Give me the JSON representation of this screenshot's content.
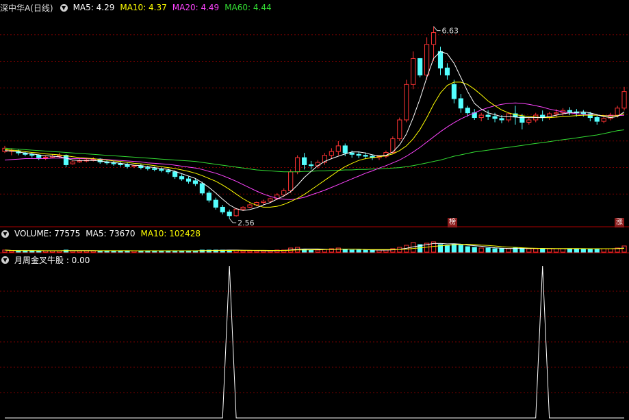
{
  "main_header": {
    "title": "深中华A(日线)",
    "ma5": "MA5: 4.29",
    "ma10": "MA10: 4.37",
    "ma20": "MA20: 4.49",
    "ma60": "MA60: 4.44"
  },
  "volume_header": {
    "label": "VOLUME: 77575",
    "ma5": "MA5: 73670",
    "ma10": "MA10: 102428"
  },
  "indicator_header": {
    "label": "月周金叉牛股 : 0.00"
  },
  "badges": {
    "left": "榜",
    "right": "涨"
  },
  "colors": {
    "up": "#ff3333",
    "down": "#54ffff",
    "ma5": "#ffffff",
    "ma10": "#ffff00",
    "ma20": "#ff44ff",
    "ma60": "#33dd33",
    "grid": "#7a0000"
  },
  "chart_data": [
    {
      "type": "candlestick",
      "annotations": [
        {
          "text": "6.63",
          "x": 63,
          "y": 6.63
        },
        {
          "text": "2.56",
          "x": 33,
          "y": 2.56
        }
      ],
      "ylim": [
        2.4,
        6.9
      ],
      "grid": true,
      "candles": [
        [
          3.98,
          4.1,
          4.05,
          3.95
        ],
        [
          4.0,
          4.05,
          4.0,
          3.9
        ],
        [
          3.98,
          4.02,
          3.95,
          3.9
        ],
        [
          3.95,
          3.98,
          3.92,
          3.88
        ],
        [
          3.92,
          3.95,
          3.9,
          3.85
        ],
        [
          3.9,
          3.92,
          3.85,
          3.8
        ],
        [
          3.85,
          3.9,
          3.86,
          3.8
        ],
        [
          3.86,
          3.92,
          3.88,
          3.84
        ],
        [
          3.88,
          3.95,
          3.9,
          3.84
        ],
        [
          3.9,
          3.92,
          3.7,
          3.65
        ],
        [
          3.72,
          3.8,
          3.76,
          3.7
        ],
        [
          3.76,
          3.82,
          3.78,
          3.74
        ],
        [
          3.78,
          3.84,
          3.8,
          3.75
        ],
        [
          3.8,
          3.86,
          3.82,
          3.77
        ],
        [
          3.82,
          3.84,
          3.76,
          3.72
        ],
        [
          3.76,
          3.8,
          3.74,
          3.7
        ],
        [
          3.74,
          3.78,
          3.72,
          3.68
        ],
        [
          3.72,
          3.76,
          3.7,
          3.66
        ],
        [
          3.7,
          3.74,
          3.66,
          3.62
        ],
        [
          3.66,
          3.7,
          3.68,
          3.63
        ],
        [
          3.68,
          3.72,
          3.64,
          3.6
        ],
        [
          3.64,
          3.68,
          3.62,
          3.58
        ],
        [
          3.62,
          3.66,
          3.6,
          3.56
        ],
        [
          3.6,
          3.64,
          3.58,
          3.54
        ],
        [
          3.58,
          3.62,
          3.55,
          3.5
        ],
        [
          3.55,
          3.58,
          3.45,
          3.4
        ],
        [
          3.45,
          3.5,
          3.4,
          3.36
        ],
        [
          3.4,
          3.45,
          3.35,
          3.3
        ],
        [
          3.36,
          3.4,
          3.3,
          3.25
        ],
        [
          3.3,
          3.34,
          3.1,
          3.05
        ],
        [
          3.1,
          3.15,
          2.95,
          2.9
        ],
        [
          2.95,
          3.0,
          2.8,
          2.75
        ],
        [
          2.8,
          2.85,
          2.7,
          2.65
        ],
        [
          2.7,
          2.75,
          2.62,
          2.56
        ],
        [
          2.62,
          2.78,
          2.76,
          2.6
        ],
        [
          2.76,
          2.82,
          2.8,
          2.72
        ],
        [
          2.8,
          2.88,
          2.85,
          2.78
        ],
        [
          2.85,
          2.92,
          2.9,
          2.82
        ],
        [
          2.9,
          2.96,
          2.93,
          2.86
        ],
        [
          2.93,
          3.0,
          2.98,
          2.9
        ],
        [
          2.98,
          3.1,
          3.06,
          2.95
        ],
        [
          3.06,
          3.2,
          3.15,
          3.02
        ],
        [
          3.15,
          3.6,
          3.55,
          3.1
        ],
        [
          3.55,
          3.9,
          3.85,
          3.5
        ],
        [
          3.85,
          3.95,
          3.7,
          3.6
        ],
        [
          3.7,
          3.78,
          3.68,
          3.6
        ],
        [
          3.68,
          3.8,
          3.75,
          3.62
        ],
        [
          3.75,
          3.95,
          3.9,
          3.7
        ],
        [
          3.9,
          4.05,
          3.98,
          3.82
        ],
        [
          3.98,
          4.2,
          4.1,
          3.9
        ],
        [
          4.1,
          4.15,
          3.95,
          3.88
        ],
        [
          3.95,
          4.0,
          3.92,
          3.85
        ],
        [
          3.92,
          3.98,
          3.9,
          3.84
        ],
        [
          3.9,
          3.96,
          3.88,
          3.82
        ],
        [
          3.88,
          3.92,
          3.85,
          3.8
        ],
        [
          3.85,
          3.9,
          3.88,
          3.8
        ],
        [
          3.88,
          4.0,
          3.96,
          3.84
        ],
        [
          3.96,
          4.3,
          4.25,
          3.92
        ],
        [
          4.25,
          4.7,
          4.65,
          4.2
        ],
        [
          4.65,
          5.5,
          5.4,
          4.6
        ],
        [
          5.4,
          6.1,
          5.95,
          5.3
        ],
        [
          5.95,
          5.8,
          5.6,
          5.55
        ],
        [
          5.6,
          6.4,
          6.25,
          5.5
        ],
        [
          6.25,
          6.63,
          6.5,
          5.9
        ],
        [
          6.1,
          6.2,
          5.75,
          5.6
        ],
        [
          5.75,
          5.85,
          5.6,
          5.5
        ],
        [
          5.4,
          5.5,
          5.1,
          5.0
        ],
        [
          5.1,
          5.2,
          4.9,
          4.8
        ],
        [
          4.9,
          4.95,
          4.8,
          4.72
        ],
        [
          4.8,
          4.88,
          4.7,
          4.65
        ],
        [
          4.7,
          4.8,
          4.75,
          4.62
        ],
        [
          4.75,
          4.85,
          4.72,
          4.65
        ],
        [
          4.72,
          4.8,
          4.68,
          4.6
        ],
        [
          4.68,
          4.75,
          4.65,
          4.58
        ],
        [
          4.65,
          4.8,
          4.78,
          4.6
        ],
        [
          4.78,
          4.95,
          4.72,
          4.55
        ],
        [
          4.72,
          4.78,
          4.6,
          4.45
        ],
        [
          4.6,
          4.7,
          4.65,
          4.55
        ],
        [
          4.65,
          4.8,
          4.75,
          4.6
        ],
        [
          4.75,
          4.85,
          4.7,
          4.62
        ],
        [
          4.7,
          4.82,
          4.78,
          4.65
        ],
        [
          4.78,
          4.88,
          4.8,
          4.7
        ],
        [
          4.8,
          4.9,
          4.85,
          4.74
        ],
        [
          4.85,
          4.92,
          4.82,
          4.75
        ],
        [
          4.82,
          4.88,
          4.8,
          4.72
        ],
        [
          4.8,
          4.86,
          4.78,
          4.72
        ],
        [
          4.78,
          4.82,
          4.7,
          4.62
        ],
        [
          4.7,
          4.74,
          4.62,
          4.55
        ],
        [
          4.62,
          4.72,
          4.68,
          4.58
        ],
        [
          4.68,
          4.8,
          4.75,
          4.64
        ],
        [
          4.75,
          4.95,
          4.9,
          4.7
        ],
        [
          4.9,
          5.35,
          5.25,
          4.85
        ]
      ],
      "ma5": [
        4.0,
        3.99,
        3.97,
        3.95,
        3.93,
        3.91,
        3.89,
        3.88,
        3.87,
        3.84,
        3.8,
        3.79,
        3.79,
        3.79,
        3.78,
        3.76,
        3.75,
        3.73,
        3.71,
        3.69,
        3.68,
        3.66,
        3.64,
        3.62,
        3.6,
        3.56,
        3.51,
        3.46,
        3.41,
        3.32,
        3.22,
        3.1,
        2.97,
        2.85,
        2.77,
        2.73,
        2.75,
        2.79,
        2.85,
        2.9,
        2.97,
        3.04,
        3.13,
        3.27,
        3.43,
        3.56,
        3.68,
        3.77,
        3.83,
        3.88,
        3.93,
        3.97,
        3.97,
        3.95,
        3.91,
        3.89,
        3.9,
        3.97,
        4.12,
        4.35,
        4.7,
        5.1,
        5.55,
        5.95,
        6.1,
        6.05,
        5.85,
        5.55,
        5.25,
        5.0,
        4.88,
        4.8,
        4.76,
        4.72,
        4.72,
        4.71,
        4.7,
        4.7,
        4.7,
        4.7,
        4.72,
        4.75,
        4.78,
        4.8,
        4.81,
        4.82,
        4.8,
        4.76,
        4.72,
        4.7,
        4.72,
        4.82
      ],
      "ma10": [
        4.02,
        4.01,
        4.0,
        3.98,
        3.96,
        3.95,
        3.93,
        3.92,
        3.91,
        3.89,
        3.87,
        3.85,
        3.84,
        3.83,
        3.81,
        3.8,
        3.78,
        3.77,
        3.75,
        3.73,
        3.72,
        3.7,
        3.68,
        3.66,
        3.64,
        3.62,
        3.59,
        3.56,
        3.52,
        3.47,
        3.41,
        3.35,
        3.27,
        3.18,
        3.08,
        2.98,
        2.9,
        2.84,
        2.8,
        2.8,
        2.82,
        2.86,
        2.92,
        2.99,
        3.07,
        3.17,
        3.27,
        3.37,
        3.47,
        3.57,
        3.66,
        3.73,
        3.79,
        3.83,
        3.85,
        3.87,
        3.89,
        3.93,
        4.0,
        4.1,
        4.25,
        4.45,
        4.7,
        4.98,
        5.22,
        5.38,
        5.45,
        5.45,
        5.4,
        5.3,
        5.18,
        5.05,
        4.95,
        4.86,
        4.8,
        4.76,
        4.74,
        4.72,
        4.71,
        4.7,
        4.7,
        4.71,
        4.72,
        4.73,
        4.74,
        4.75,
        4.75,
        4.75,
        4.74,
        4.73,
        4.74,
        4.78
      ],
      "ma20": [
        3.8,
        3.81,
        3.82,
        3.83,
        3.83,
        3.83,
        3.83,
        3.84,
        3.84,
        3.84,
        3.83,
        3.83,
        3.83,
        3.82,
        3.82,
        3.81,
        3.8,
        3.79,
        3.78,
        3.77,
        3.76,
        3.74,
        3.73,
        3.72,
        3.71,
        3.69,
        3.67,
        3.65,
        3.63,
        3.6,
        3.56,
        3.52,
        3.47,
        3.41,
        3.35,
        3.28,
        3.21,
        3.14,
        3.08,
        3.03,
        2.99,
        2.97,
        2.96,
        2.98,
        3.01,
        3.06,
        3.11,
        3.16,
        3.22,
        3.28,
        3.34,
        3.4,
        3.46,
        3.52,
        3.57,
        3.63,
        3.68,
        3.74,
        3.8,
        3.88,
        3.97,
        4.07,
        4.18,
        4.29,
        4.4,
        4.5,
        4.59,
        4.67,
        4.74,
        4.8,
        4.86,
        4.91,
        4.95,
        4.98,
        5.0,
        5.01,
        5.0,
        4.98,
        4.95,
        4.92,
        4.88,
        4.85,
        4.82,
        4.8,
        4.78,
        4.77,
        4.76,
        4.75,
        4.74,
        4.74,
        4.74,
        4.75
      ],
      "ma60": [
        4.05,
        4.04,
        4.03,
        4.02,
        4.01,
        4.0,
        3.99,
        3.98,
        3.97,
        3.96,
        3.95,
        3.94,
        3.93,
        3.92,
        3.91,
        3.9,
        3.89,
        3.88,
        3.87,
        3.86,
        3.85,
        3.84,
        3.83,
        3.82,
        3.81,
        3.8,
        3.79,
        3.78,
        3.77,
        3.75,
        3.73,
        3.71,
        3.69,
        3.67,
        3.65,
        3.63,
        3.61,
        3.59,
        3.58,
        3.57,
        3.56,
        3.55,
        3.55,
        3.55,
        3.56,
        3.56,
        3.57,
        3.57,
        3.58,
        3.58,
        3.59,
        3.59,
        3.6,
        3.6,
        3.61,
        3.61,
        3.62,
        3.63,
        3.64,
        3.66,
        3.68,
        3.71,
        3.74,
        3.77,
        3.8,
        3.84,
        3.88,
        3.91,
        3.94,
        3.97,
        3.99,
        4.01,
        4.03,
        4.05,
        4.07,
        4.09,
        4.11,
        4.13,
        4.15,
        4.17,
        4.19,
        4.21,
        4.23,
        4.25,
        4.27,
        4.29,
        4.31,
        4.33,
        4.36,
        4.39,
        4.42,
        4.44
      ]
    },
    {
      "type": "bar",
      "volumes": [
        3,
        2,
        2,
        2,
        2,
        2,
        2,
        2,
        2,
        3,
        2,
        2,
        2,
        2,
        2,
        2,
        2,
        2,
        2,
        2,
        2,
        2,
        2,
        2,
        2,
        2,
        2,
        2,
        2,
        3,
        3,
        3,
        3,
        3,
        3,
        2,
        2,
        2,
        2,
        2,
        3,
        3,
        6,
        7,
        4,
        3,
        3,
        4,
        5,
        6,
        4,
        3,
        3,
        3,
        3,
        3,
        3,
        5,
        7,
        10,
        14,
        11,
        13,
        15,
        11,
        10,
        12,
        10,
        8,
        7,
        6,
        6,
        5,
        5,
        5,
        6,
        6,
        5,
        5,
        5,
        5,
        5,
        5,
        5,
        5,
        5,
        5,
        5,
        5,
        5,
        6,
        9
      ],
      "ylim": [
        0,
        16
      ]
    },
    {
      "type": "line",
      "values": [
        0,
        0,
        0,
        0,
        0,
        0,
        0,
        0,
        0,
        0,
        0,
        0,
        0,
        0,
        0,
        0,
        0,
        0,
        0,
        0,
        0,
        0,
        0,
        0,
        0,
        0,
        0,
        0,
        0,
        0,
        0,
        0,
        0,
        1,
        0,
        0,
        0,
        0,
        0,
        0,
        0,
        0,
        0,
        0,
        0,
        0,
        0,
        0,
        0,
        0,
        0,
        0,
        0,
        0,
        0,
        0,
        0,
        0,
        0,
        0,
        0,
        0,
        0,
        0,
        0,
        0,
        0,
        0,
        0,
        0,
        0,
        0,
        0,
        0,
        0,
        0,
        0,
        0,
        0,
        1,
        0,
        0,
        0,
        0,
        0,
        0,
        0,
        0,
        0,
        0,
        0,
        0
      ],
      "ylim": [
        0,
        1
      ]
    }
  ]
}
